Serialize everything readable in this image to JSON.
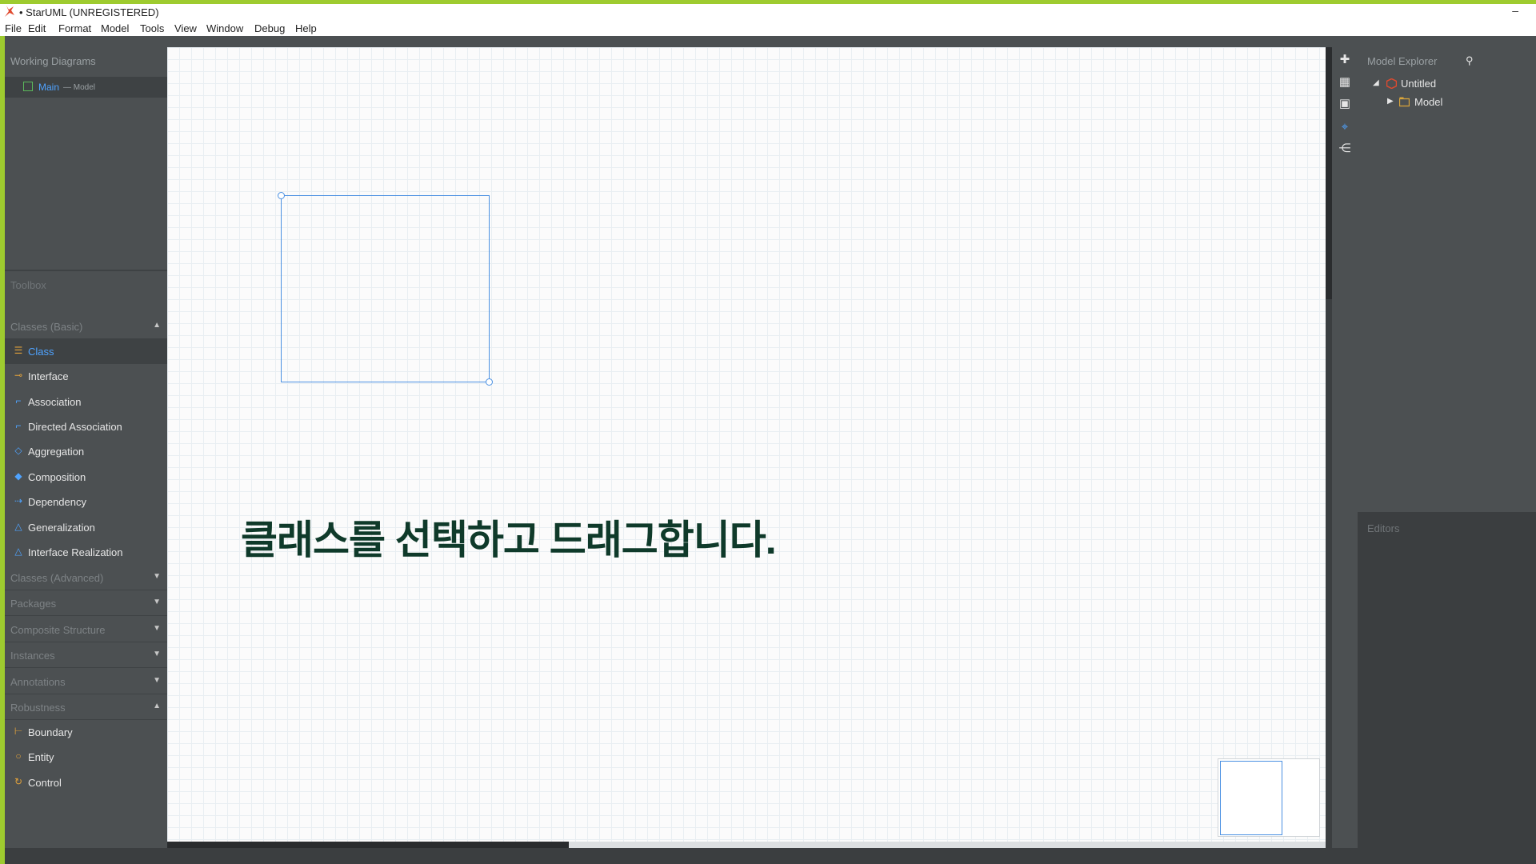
{
  "window": {
    "title": "• StarUML (UNREGISTERED)",
    "minimize_glyph": "–"
  },
  "menu": [
    "File",
    "Edit",
    "Format",
    "Model",
    "Tools",
    "View",
    "Window",
    "Debug",
    "Help"
  ],
  "working_diagrams": {
    "header": "Working Diagrams",
    "item": {
      "label": "Main",
      "sub": "— Model",
      "icon": "class-diagram-icon"
    }
  },
  "toolbox": {
    "header": "Toolbox",
    "sections": [
      {
        "label": "Classes (Basic)",
        "expanded": true
      },
      {
        "label": "Classes (Advanced)",
        "expanded": false
      },
      {
        "label": "Packages",
        "expanded": false
      },
      {
        "label": "Composite Structure",
        "expanded": false
      },
      {
        "label": "Instances",
        "expanded": false
      },
      {
        "label": "Annotations",
        "expanded": false
      },
      {
        "label": "Robustness",
        "expanded": true
      }
    ],
    "classes_basic": [
      {
        "label": "Class",
        "icon": "class-icon",
        "selected": true
      },
      {
        "label": "Interface",
        "icon": "interface-icon"
      },
      {
        "label": "Association",
        "icon": "association-icon"
      },
      {
        "label": "Directed Association",
        "icon": "directed-association-icon"
      },
      {
        "label": "Aggregation",
        "icon": "aggregation-icon"
      },
      {
        "label": "Composition",
        "icon": "composition-icon"
      },
      {
        "label": "Dependency",
        "icon": "dependency-icon"
      },
      {
        "label": "Generalization",
        "icon": "generalization-icon"
      },
      {
        "label": "Interface Realization",
        "icon": "interface-realization-icon"
      }
    ],
    "robustness": [
      {
        "label": "Boundary",
        "icon": "boundary-icon"
      },
      {
        "label": "Entity",
        "icon": "entity-icon"
      },
      {
        "label": "Control",
        "icon": "control-icon"
      }
    ]
  },
  "canvas": {
    "instruction": "클래스를 선택하고 드래그합니다."
  },
  "side_icons": [
    "extensions-icon",
    "layout-icon",
    "markdown-icon",
    "navigator-icon",
    "share-icon"
  ],
  "model_explorer": {
    "header": "Model Explorer",
    "tree": [
      {
        "label": "Untitled",
        "icon": "project-icon",
        "expanded": true
      },
      {
        "label": "Model",
        "icon": "model-package-icon",
        "expanded": false
      }
    ]
  },
  "editors": {
    "header": "Editors"
  },
  "colors": {
    "accent": "#9ecb2f",
    "selection": "#4fa3ff",
    "panel": "#4c5052",
    "instruction": "#0f3a2a"
  }
}
